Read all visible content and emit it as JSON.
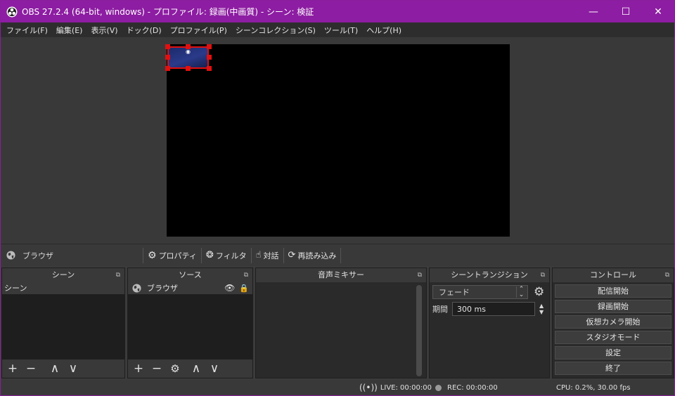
{
  "window": {
    "title": "OBS 27.2.4 (64-bit, windows) - プロファイル: 録画(中画質) - シーン: 検証",
    "minimize": "—",
    "maximize": "☐",
    "close": "✕"
  },
  "menu": [
    "ファイル(F)",
    "編集(E)",
    "表示(V)",
    "ドック(D)",
    "プロファイル(P)",
    "シーンコレクション(S)",
    "ツール(T)",
    "ヘルプ(H)"
  ],
  "source_toolbar": {
    "selected_source": "ブラウザ",
    "properties": "プロパティ",
    "filters": "フィルタ",
    "interact": "対話",
    "reload": "再読み込み"
  },
  "docks": {
    "scenes": {
      "title": "シーン",
      "items": [
        "シーン"
      ]
    },
    "sources": {
      "title": "ソース",
      "items": [
        "ブラウザ"
      ]
    },
    "mixer": {
      "title": "音声ミキサー"
    },
    "transitions": {
      "title": "シーントランジション",
      "selected": "フェード",
      "duration_label": "期間",
      "duration_value": "300 ms"
    },
    "controls": {
      "title": "コントロール",
      "buttons": [
        "配信開始",
        "録画開始",
        "仮想カメラ開始",
        "スタジオモード",
        "設定",
        "終了"
      ]
    }
  },
  "status": {
    "live": "LIVE: 00:00:00",
    "rec": "REC: 00:00:00",
    "cpu": "CPU: 0.2%, 30.00 fps"
  },
  "colors": {
    "titlebar": "#8d1da2",
    "selection": "#e01010"
  }
}
